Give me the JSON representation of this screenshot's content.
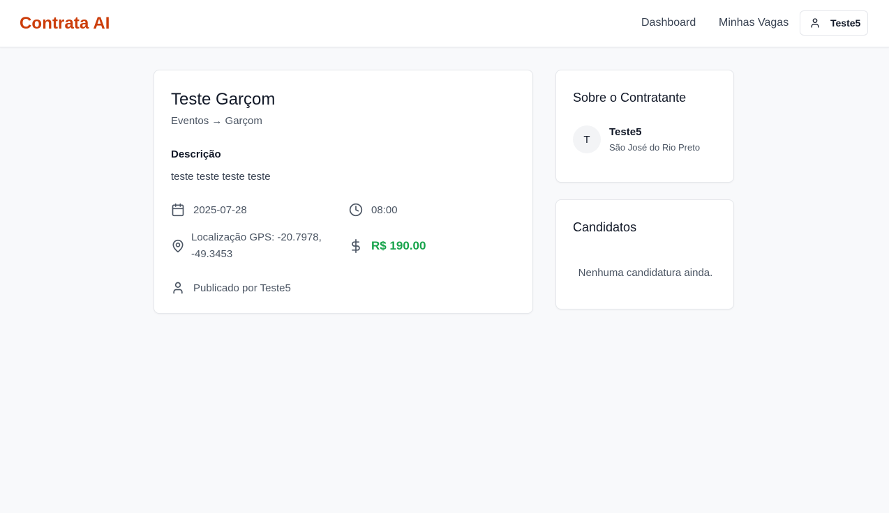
{
  "header": {
    "brand": "Contrata AI",
    "nav": {
      "dashboard": "Dashboard",
      "minhas_vagas": "Minhas Vagas"
    },
    "user": {
      "name": "Teste5",
      "icon": "user-icon"
    }
  },
  "job": {
    "title": "Teste Garçom",
    "category_path": "Eventos → Garçom",
    "description_label": "Descrição",
    "description": "teste teste teste teste",
    "date": "2025-07-28",
    "time": "08:00",
    "location": "Localização GPS: -20.7978, -49.3453",
    "price": "R$ 190.00",
    "published_by": "Publicado por Teste5",
    "icons": {
      "date": "calendar-icon",
      "time": "clock-icon",
      "location": "map-pin-icon",
      "price": "dollar-icon",
      "author": "user-icon"
    },
    "price_color": "#16a34a"
  },
  "owner": {
    "title": "Sobre o Contratante",
    "avatar_initial": "T",
    "name": "Teste5",
    "city": "São José do Rio Preto"
  },
  "candidates": {
    "title": "Candidatos",
    "empty_message": "Nenhuma candidatura ainda."
  },
  "colors": {
    "brand": "#cc3d0a",
    "price": "#16a34a",
    "background": "#f8f9fb"
  }
}
